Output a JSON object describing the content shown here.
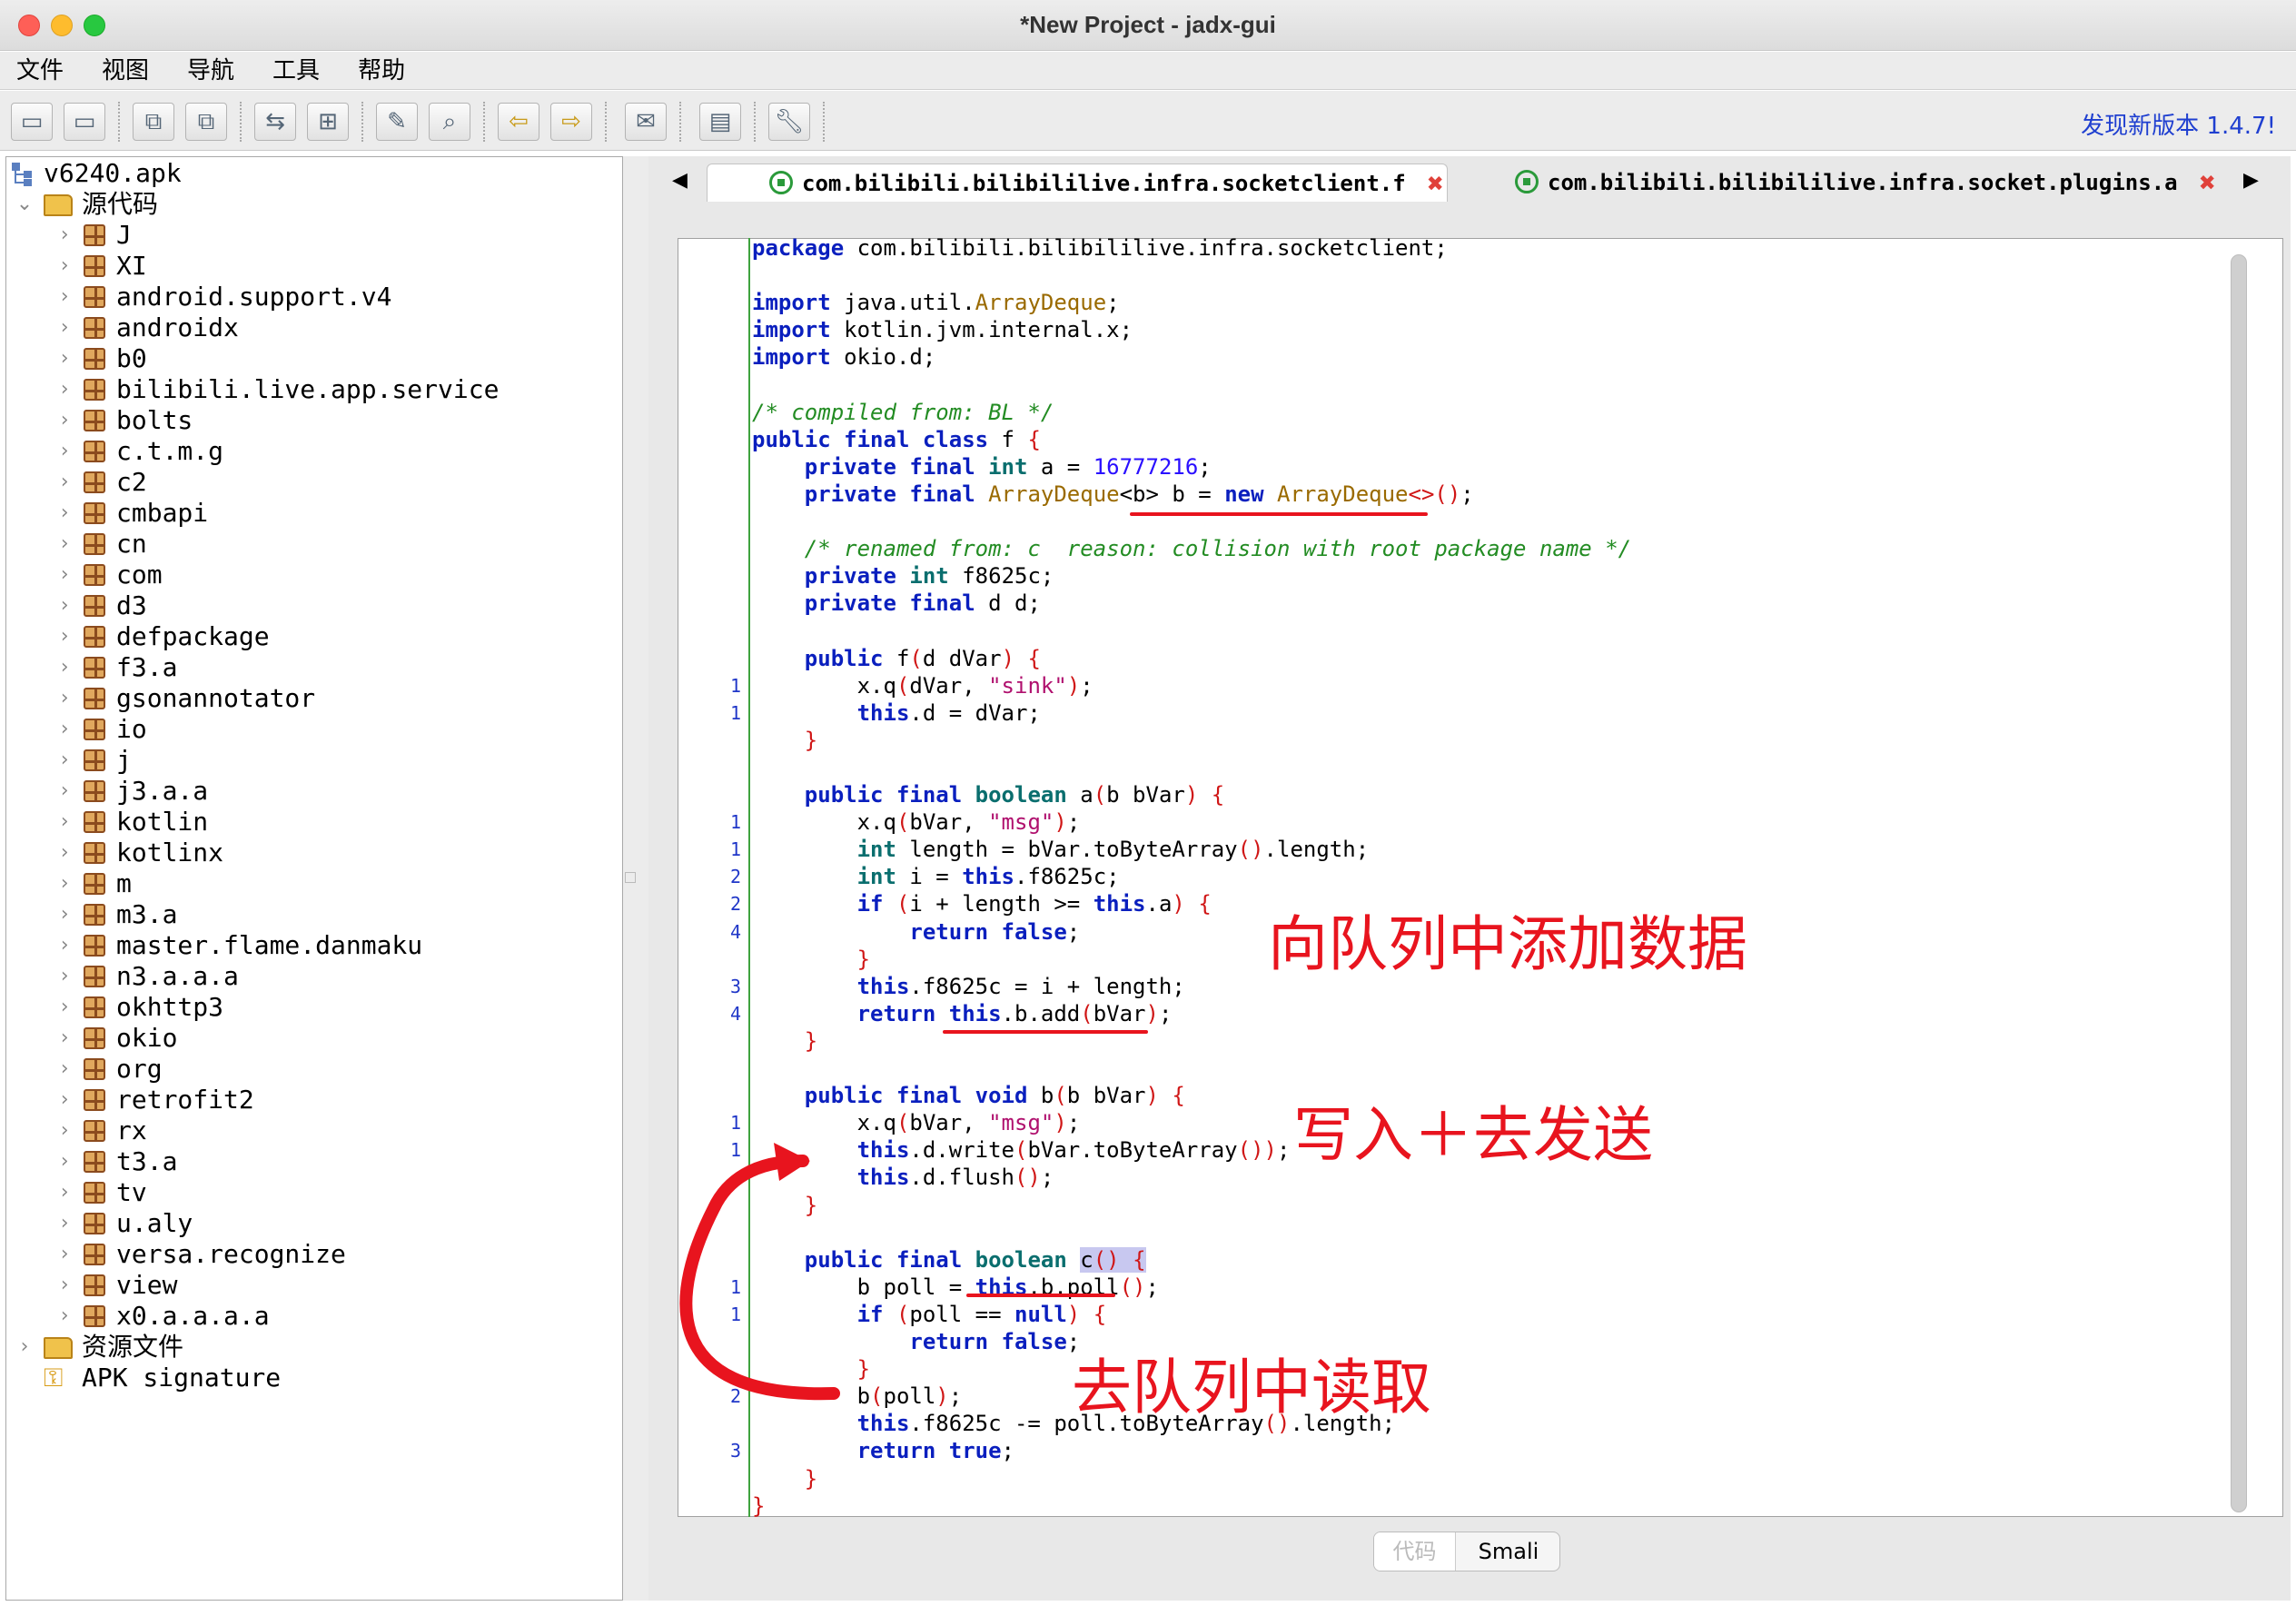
{
  "window": {
    "title": "*New Project - jadx-gui"
  },
  "menu": [
    "文件",
    "视图",
    "导航",
    "工具",
    "帮助"
  ],
  "toolbar": {
    "update_label": "发现新版本 1.4.7!"
  },
  "tree": {
    "root": "v6240.apk",
    "source_label": "源代码",
    "packages": [
      "J",
      "XI",
      "android.support.v4",
      "androidx",
      "b0",
      "bilibili.live.app.service",
      "bolts",
      "c.t.m.g",
      "c2",
      "cmbapi",
      "cn",
      "com",
      "d3",
      "defpackage",
      "f3.a",
      "gsonannotator",
      "io",
      "j",
      "j3.a.a",
      "kotlin",
      "kotlinx",
      "m",
      "m3.a",
      "master.flame.danmaku",
      "n3.a.a.a",
      "okhttp3",
      "okio",
      "org",
      "retrofit2",
      "rx",
      "t3.a",
      "tv",
      "u.aly",
      "versa.recognize",
      "view",
      "x0.a.a.a.a"
    ],
    "resources_label": "资源文件",
    "signature_label": "APK signature"
  },
  "tabs": [
    {
      "label": "com.bilibili.bilibililive.infra.socketclient.f",
      "active": true
    },
    {
      "label": "com.bilibili.bilibililive.infra.socket.plugins.a",
      "active": false
    }
  ],
  "code": {
    "lines": [
      {
        "n": "",
        "t": "<span class='kw'>package</span> com.bilibili.bilibililive.infra.socketclient;"
      },
      {
        "n": "",
        "t": ""
      },
      {
        "n": "",
        "t": "<span class='kw'>import</span> java.util.<span class='cls'>ArrayDeque</span>;"
      },
      {
        "n": "",
        "t": "<span class='kw'>import</span> kotlin.jvm.internal.x;"
      },
      {
        "n": "",
        "t": "<span class='kw'>import</span> okio.d;"
      },
      {
        "n": "",
        "t": ""
      },
      {
        "n": "",
        "t": "<span class='cm'>/* compiled from: BL */</span>"
      },
      {
        "n": "",
        "t": "<span class='kw'>public final class</span> f <span class='br'>{</span>"
      },
      {
        "n": "",
        "t": "    <span class='kw'>private final</span> <span class='ty'>int</span> a = <span class='num'>16777216</span>;"
      },
      {
        "n": "",
        "t": "    <span class='kw'>private final</span> <span class='cls'>ArrayDeque</span>&lt;b&gt; b = <span class='kw'>new</span> <span class='cls'>ArrayDeque</span><span class='br'>&lt;&gt;()</span>;"
      },
      {
        "n": "",
        "t": ""
      },
      {
        "n": "",
        "t": "    <span class='cm'>/* renamed from: c  reason: collision with root package name */</span>"
      },
      {
        "n": "",
        "t": "    <span class='kw'>private</span> <span class='ty'>int</span> f8625c;"
      },
      {
        "n": "",
        "t": "    <span class='kw'>private final</span> d d;"
      },
      {
        "n": "",
        "t": ""
      },
      {
        "n": "",
        "t": "    <span class='kw'>public</span> f<span class='br'>(</span>d dVar<span class='br'>)</span> <span class='br'>{</span>"
      },
      {
        "n": "1",
        "t": "        x.q<span class='br'>(</span>dVar, <span class='str'>\"sink\"</span><span class='br'>)</span>;"
      },
      {
        "n": "1",
        "t": "        <span class='kw'>this</span>.d = dVar;"
      },
      {
        "n": "",
        "t": "    <span class='br'>}</span>"
      },
      {
        "n": "",
        "t": ""
      },
      {
        "n": "",
        "t": "    <span class='kw'>public final</span> <span class='ty'>boolean</span> a<span class='br'>(</span>b bVar<span class='br'>)</span> <span class='br'>{</span>"
      },
      {
        "n": "1",
        "t": "        x.q<span class='br'>(</span>bVar, <span class='str'>\"msg\"</span><span class='br'>)</span>;"
      },
      {
        "n": "1",
        "t": "        <span class='ty'>int</span> length = bVar.toByteArray<span class='br'>()</span>.length;"
      },
      {
        "n": "2",
        "t": "        <span class='ty'>int</span> i = <span class='kw'>this</span>.f8625c;"
      },
      {
        "n": "2",
        "t": "        <span class='kw'>if</span> <span class='br'>(</span>i + length &gt;= <span class='kw'>this</span>.a<span class='br'>)</span> <span class='br'>{</span>"
      },
      {
        "n": "4",
        "t": "            <span class='kw'>return false</span>;"
      },
      {
        "n": "",
        "t": "        <span class='br'>}</span>"
      },
      {
        "n": "3",
        "t": "        <span class='kw'>this</span>.f8625c = i + length;"
      },
      {
        "n": "4",
        "t": "        <span class='kw'>return this</span>.b.add<span class='br'>(</span>bVar<span class='br'>)</span>;"
      },
      {
        "n": "",
        "t": "    <span class='br'>}</span>"
      },
      {
        "n": "",
        "t": ""
      },
      {
        "n": "",
        "t": "    <span class='kw'>public final void</span> b<span class='br'>(</span>b bVar<span class='br'>)</span> <span class='br'>{</span>"
      },
      {
        "n": "1",
        "t": "        x.q<span class='br'>(</span>bVar, <span class='str'>\"msg\"</span><span class='br'>)</span>;"
      },
      {
        "n": "1",
        "t": "        <span class='kw'>this</span>.d.write<span class='br'>(</span>bVar.toByteArray<span class='br'>())</span>;"
      },
      {
        "n": "",
        "t": "        <span class='kw'>this</span>.d.flush<span class='br'>()</span>;"
      },
      {
        "n": "",
        "t": "    <span class='br'>}</span>"
      },
      {
        "n": "",
        "t": ""
      },
      {
        "n": "",
        "t": "    <span class='kw'>public final</span> <span class='ty'>boolean</span> <span class='hl'>c<span class='br'>()</span> <span class='br'>{</span></span>"
      },
      {
        "n": "1",
        "t": "        b poll = <span class='kw'>this</span>.b.poll<span class='br'>()</span>;"
      },
      {
        "n": "1",
        "t": "        <span class='kw'>if</span> <span class='br'>(</span>poll == <span class='kw'>null</span><span class='br'>)</span> <span class='br'>{</span>"
      },
      {
        "n": "",
        "t": "            <span class='kw'>return false</span>;"
      },
      {
        "n": "",
        "t": "        <span class='br'>}</span>"
      },
      {
        "n": "2",
        "t": "        b<span class='br'>(</span>poll<span class='br'>)</span>;"
      },
      {
        "n": "",
        "t": "        <span class='kw'>this</span>.f8625c -= poll.toByteArray<span class='br'>()</span>.length;"
      },
      {
        "n": "3",
        "t": "        <span class='kw'>return true</span>;"
      },
      {
        "n": "",
        "t": "    <span class='br'>}</span>"
      },
      {
        "n": "",
        "t": "<span class='br'>}</span>"
      }
    ]
  },
  "bottom_tabs": [
    {
      "label": "代码",
      "active": true
    },
    {
      "label": "Smali",
      "active": false
    }
  ],
  "annotations": {
    "add": "向队列中添加数据",
    "send": "写入＋去发送",
    "read": "去队列中读取",
    "color": "#e8141e"
  }
}
